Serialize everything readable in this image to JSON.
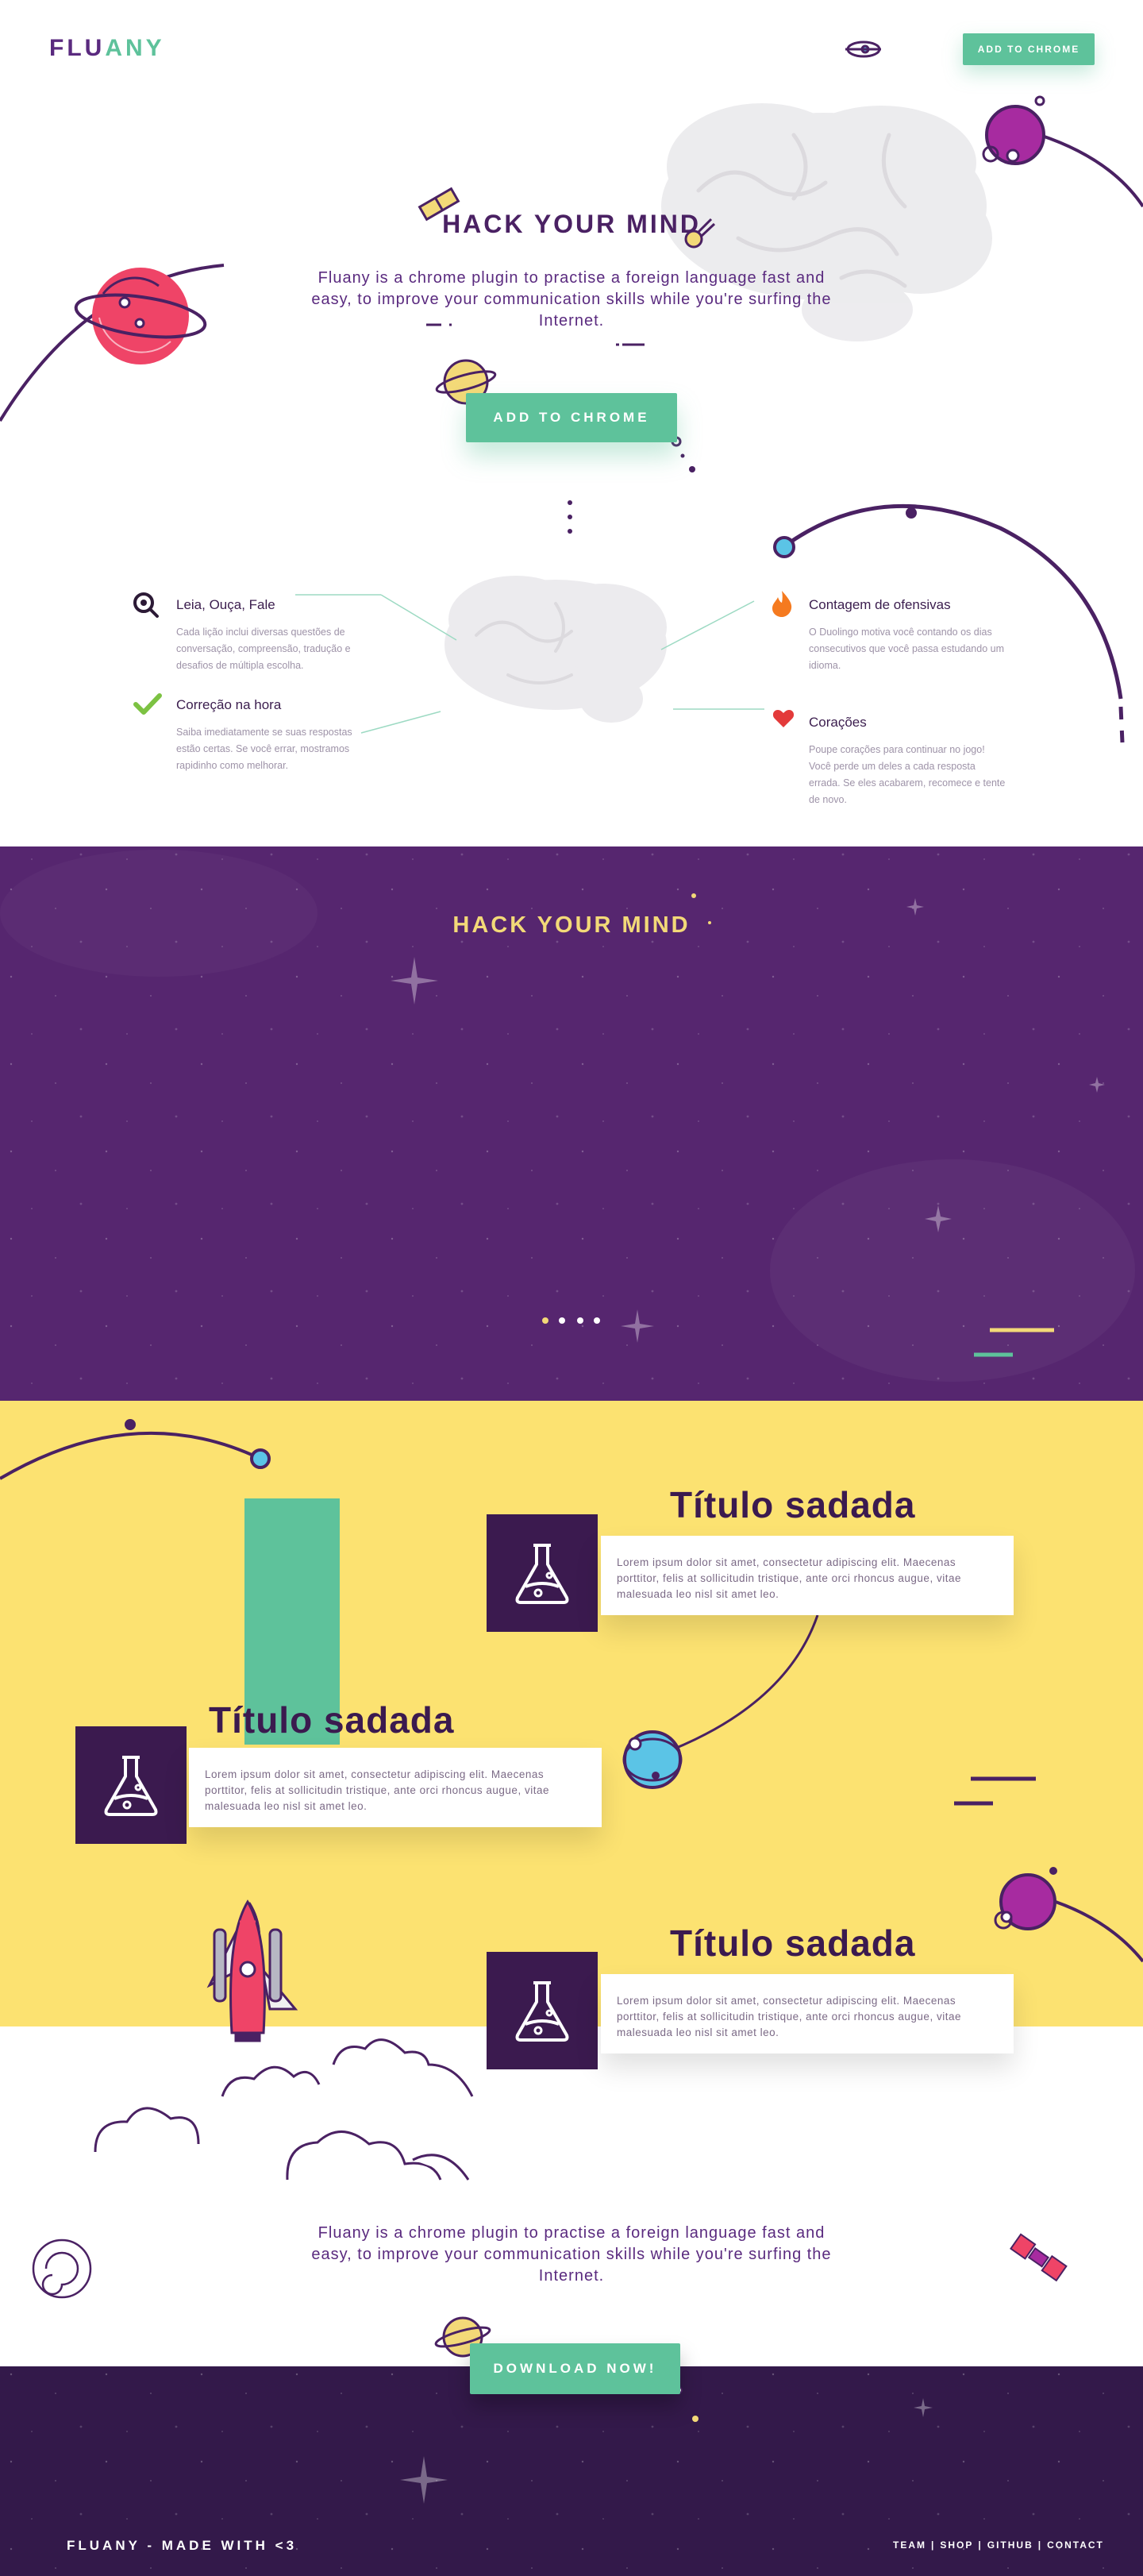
{
  "header": {
    "logo_part1": "FLU",
    "logo_part2": "ANY",
    "cta_label": "ADD TO CHROME"
  },
  "hero": {
    "title": "HACK YOUR MIND",
    "description": "Fluany is a chrome plugin to practise a foreign language fast and easy, to improve your communication skills while you're surfing the Internet.",
    "cta_label": "ADD TO CHROME"
  },
  "features": [
    {
      "title": "Leia, Ouça, Fale",
      "description": "Cada lição inclui diversas questões de conversação, compreensão, tradução e desafios de múltipla escolha.",
      "icon": "search-icon"
    },
    {
      "title": "Correção na hora",
      "description": "Saiba imediatamente se suas respostas estão certas. Se você errar, mostramos rapidinho como melhorar.",
      "icon": "check-icon"
    },
    {
      "title": "Contagem de ofensivas",
      "description": "O Duolingo motiva você contando os dias consecutivos que você passa estudando um idioma.",
      "icon": "flame-icon"
    },
    {
      "title": "Corações",
      "description": "Poupe corações para continuar no jogo! Você perde um deles a cada resposta errada. Se eles acabarem, recomece e tente de novo.",
      "icon": "heart-icon"
    }
  ],
  "video_section": {
    "title": "HACK YOUR MIND"
  },
  "cards": [
    {
      "title": "Título sadada",
      "text": "Lorem ipsum dolor sit amet, consectetur adipiscing elit. Maecenas porttitor, felis at sollicitudin tristique, ante orci rhoncus augue, vitae malesuada leo nisl sit amet leo.",
      "icon": "flask-icon"
    },
    {
      "title": "Título sadada",
      "text": "Lorem ipsum dolor sit amet, consectetur adipiscing elit. Maecenas porttitor, felis at sollicitudin tristique, ante orci rhoncus augue, vitae malesuada leo nisl sit amet leo.",
      "icon": "flask-icon"
    },
    {
      "title": "Título sadada",
      "text": "Lorem ipsum dolor sit amet, consectetur adipiscing elit. Maecenas porttitor, felis at sollicitudin tristique, ante orci rhoncus augue, vitae malesuada leo nisl sit amet leo.",
      "icon": "flask-icon"
    }
  ],
  "bottom": {
    "description": "Fluany is a chrome plugin to practise a foreign language fast and easy, to improve your communication skills while you're surfing the Internet.",
    "cta_label": "DOWNLOAD NOW!"
  },
  "footer": {
    "brand": "FLUANY - MADE WITH <3",
    "links": [
      "TEAM",
      "SHOP",
      "GITHUB",
      "CONTACT"
    ],
    "separator": "|"
  },
  "colors": {
    "purple": "#56266f",
    "dark_purple": "#33194a",
    "green": "#5ec29b",
    "yellow": "#fce271",
    "red_planet": "#ef4467",
    "magenta_planet": "#a72ba0",
    "blue_planet": "#5bc4e6"
  }
}
